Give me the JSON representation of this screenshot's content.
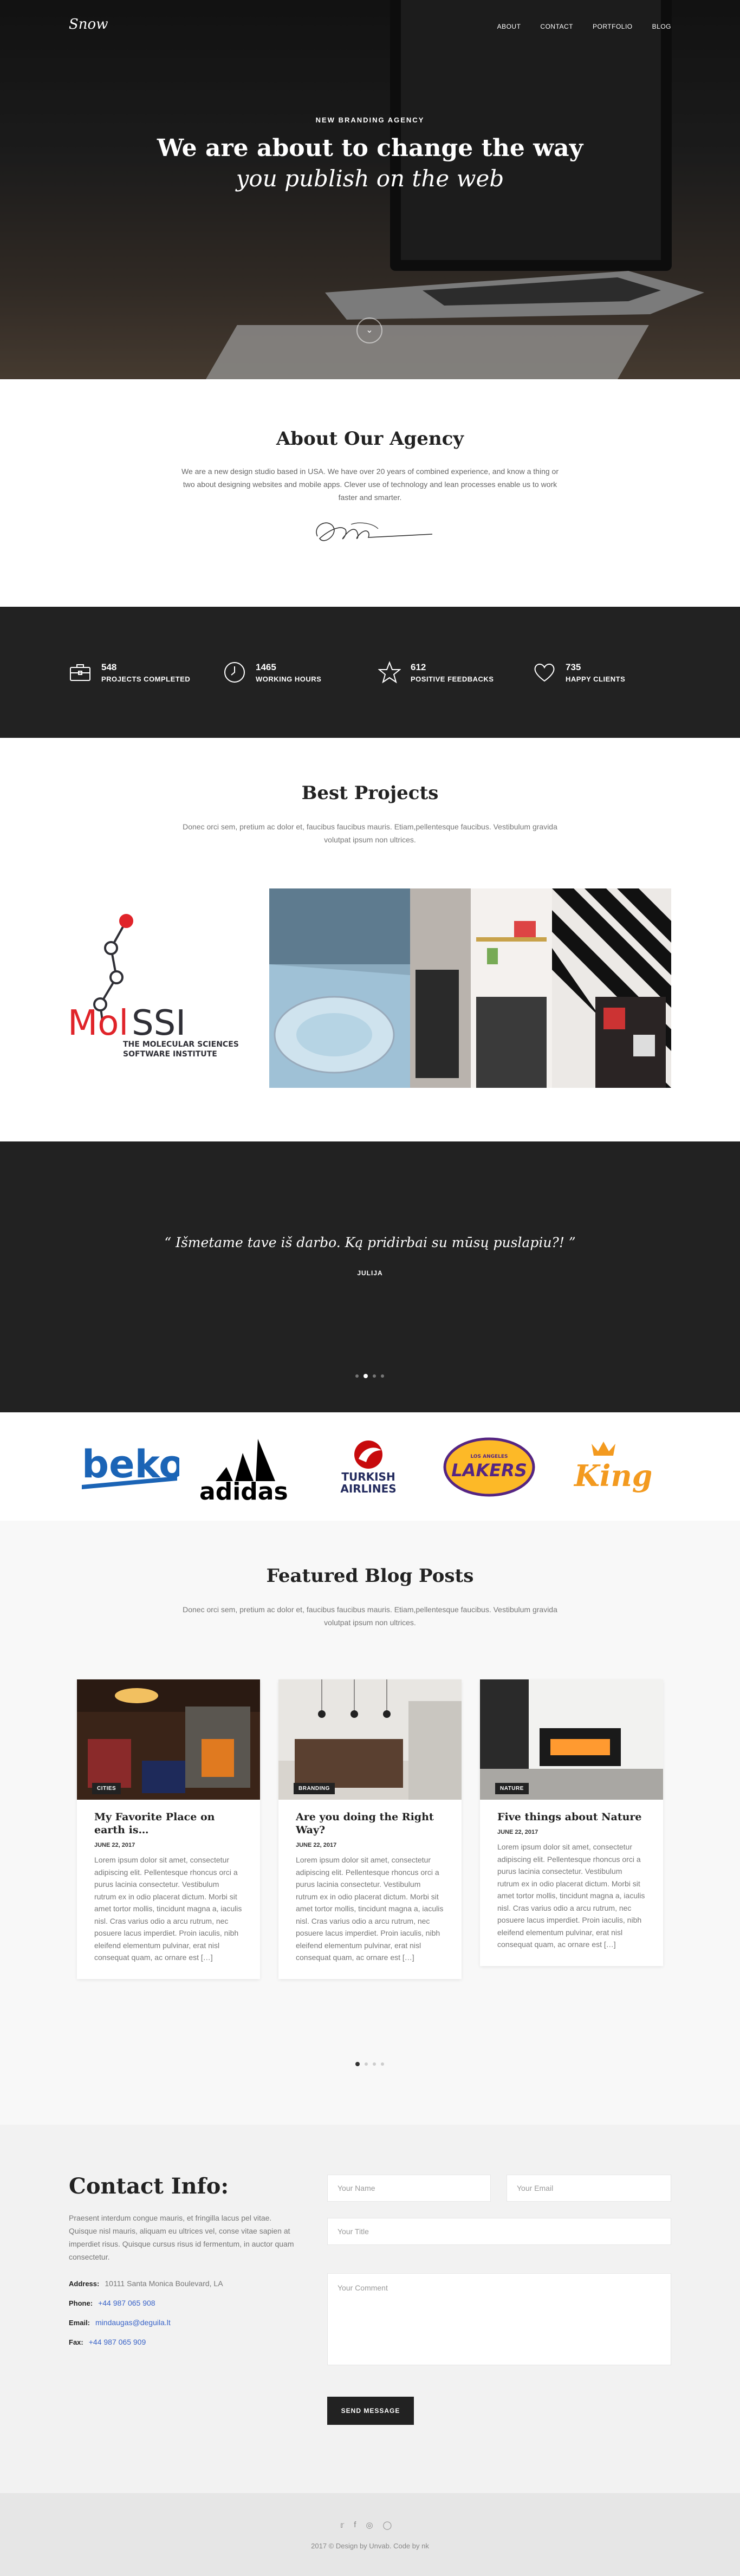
{
  "header": {
    "logo": "Snow",
    "nav": [
      "ABOUT",
      "CONTACT",
      "PORTFOLIO",
      "BLOG"
    ]
  },
  "hero": {
    "kicker": "NEW BRANDING AGENCY",
    "title": "We are about to change the way",
    "subtitle": "you publish on the web",
    "scroll_icon": "chevron-down-icon"
  },
  "about": {
    "title": "About Our Agency",
    "text": "We are a new design studio based in USA. We have over 20 years of combined experience, and know a thing or two about designing websites and mobile apps. Clever use of technology and lean processes enable us to work faster and smarter."
  },
  "stats": [
    {
      "icon": "briefcase-icon",
      "value": "548",
      "label": "PROJECTS COMPLETED"
    },
    {
      "icon": "clock-icon",
      "value": "1465",
      "label": "WORKING HOURS"
    },
    {
      "icon": "star-icon",
      "value": "612",
      "label": "POSITIVE FEEDBACKS"
    },
    {
      "icon": "heart-icon",
      "value": "735",
      "label": "HAPPY CLIENTS"
    }
  ],
  "projects": {
    "title": "Best Projects",
    "text": "Donec orci sem, pretium ac dolor et, faucibus faucibus mauris. Etiam,pellentesque faucibus. Vestibulum gravida volutpat ipsum non ultrices.",
    "molssi": {
      "brand_left": "Mol",
      "brand_right": "SSI",
      "line1": "THE MOLECULAR SCIENCES",
      "line2": "SOFTWARE INSTITUTE"
    }
  },
  "testimonial": {
    "quote": "Išmetame tave iš darbo. Ką pridirbai su mūsų puslapiu?!",
    "author": "JULIJA"
  },
  "clients": {
    "beko": "beko",
    "adidas": "adidas",
    "turkish1": "TURKISH",
    "turkish2": "AIRLINES",
    "lakers_top": "LOS ANGELES",
    "lakers": "LAKERS",
    "king": "King"
  },
  "blog": {
    "title": "Featured Blog Posts",
    "text": "Donec orci sem, pretium ac dolor et, faucibus faucibus mauris. Etiam,pellentesque faucibus. Vestibulum gravida volutpat ipsum non ultrices.",
    "posts": [
      {
        "tag": "CITIES",
        "title": "My Favorite Place on earth is…",
        "date": "JUNE 22, 2017",
        "body": "Lorem ipsum dolor sit amet, consectetur adipiscing elit. Pellentesque rhoncus orci a purus lacinia consectetur. Vestibulum rutrum ex in odio placerat dictum. Morbi sit amet tortor mollis, tincidunt magna a, iaculis nisl. Cras varius odio a arcu rutrum, nec posuere lacus imperdiet. Proin iaculis, nibh eleifend elementum pulvinar, erat nisl consequat quam, ac ornare est […]"
      },
      {
        "tag": "BRANDING",
        "title": "Are you doing the Right Way?",
        "date": "JUNE 22, 2017",
        "body": "Lorem ipsum dolor sit amet, consectetur adipiscing elit. Pellentesque rhoncus orci a purus lacinia consectetur. Vestibulum rutrum ex in odio placerat dictum. Morbi sit amet tortor mollis, tincidunt magna a, iaculis nisl. Cras varius odio a arcu rutrum, nec posuere lacus imperdiet. Proin iaculis, nibh eleifend elementum pulvinar, erat nisl consequat quam, ac ornare est […]"
      },
      {
        "tag": "NATURE",
        "title": "Five things about Nature",
        "date": "JUNE 22, 2017",
        "body": "Lorem ipsum dolor sit amet, consectetur adipiscing elit. Pellentesque rhoncus orci a purus lacinia consectetur. Vestibulum rutrum ex in odio placerat dictum. Morbi sit amet tortor mollis, tincidunt magna a, iaculis nisl. Cras varius odio a arcu rutrum, nec posuere lacus imperdiet. Proin iaculis, nibh eleifend elementum pulvinar, erat nisl consequat quam, ac ornare est […]"
      }
    ]
  },
  "contact": {
    "title": "Contact Info:",
    "text": "Praesent interdum congue mauris, et fringilla lacus pel vitae. Quisque nisl mauris, aliquam eu ultrices vel, conse vitae sapien at imperdiet risus. Quisque cursus risus id fermentum, in auctor quam consectetur.",
    "address_label": "Address:",
    "address": "10111 Santa Monica Boulevard, LA",
    "phone_label": "Phone:",
    "phone": "+44 987 065 908",
    "email_label": "Email:",
    "email": "mindaugas@deguila.lt",
    "fax_label": "Fax:",
    "fax": "+44 987 065 909",
    "form": {
      "name_placeholder": "Your Name",
      "email_placeholder": "Your Email",
      "title_placeholder": "Your Title",
      "comment_placeholder": "Your Comment",
      "send_label": "SEND MESSAGE"
    }
  },
  "footer": {
    "social": [
      "twitter-icon",
      "facebook-icon",
      "dribbble-icon",
      "instagram-icon"
    ],
    "copyright": "2017 © Design by Unvab. Code by nk"
  },
  "colors": {
    "dark": "#222222",
    "link": "#3a64c8",
    "molssi_red": "#e0242a"
  }
}
